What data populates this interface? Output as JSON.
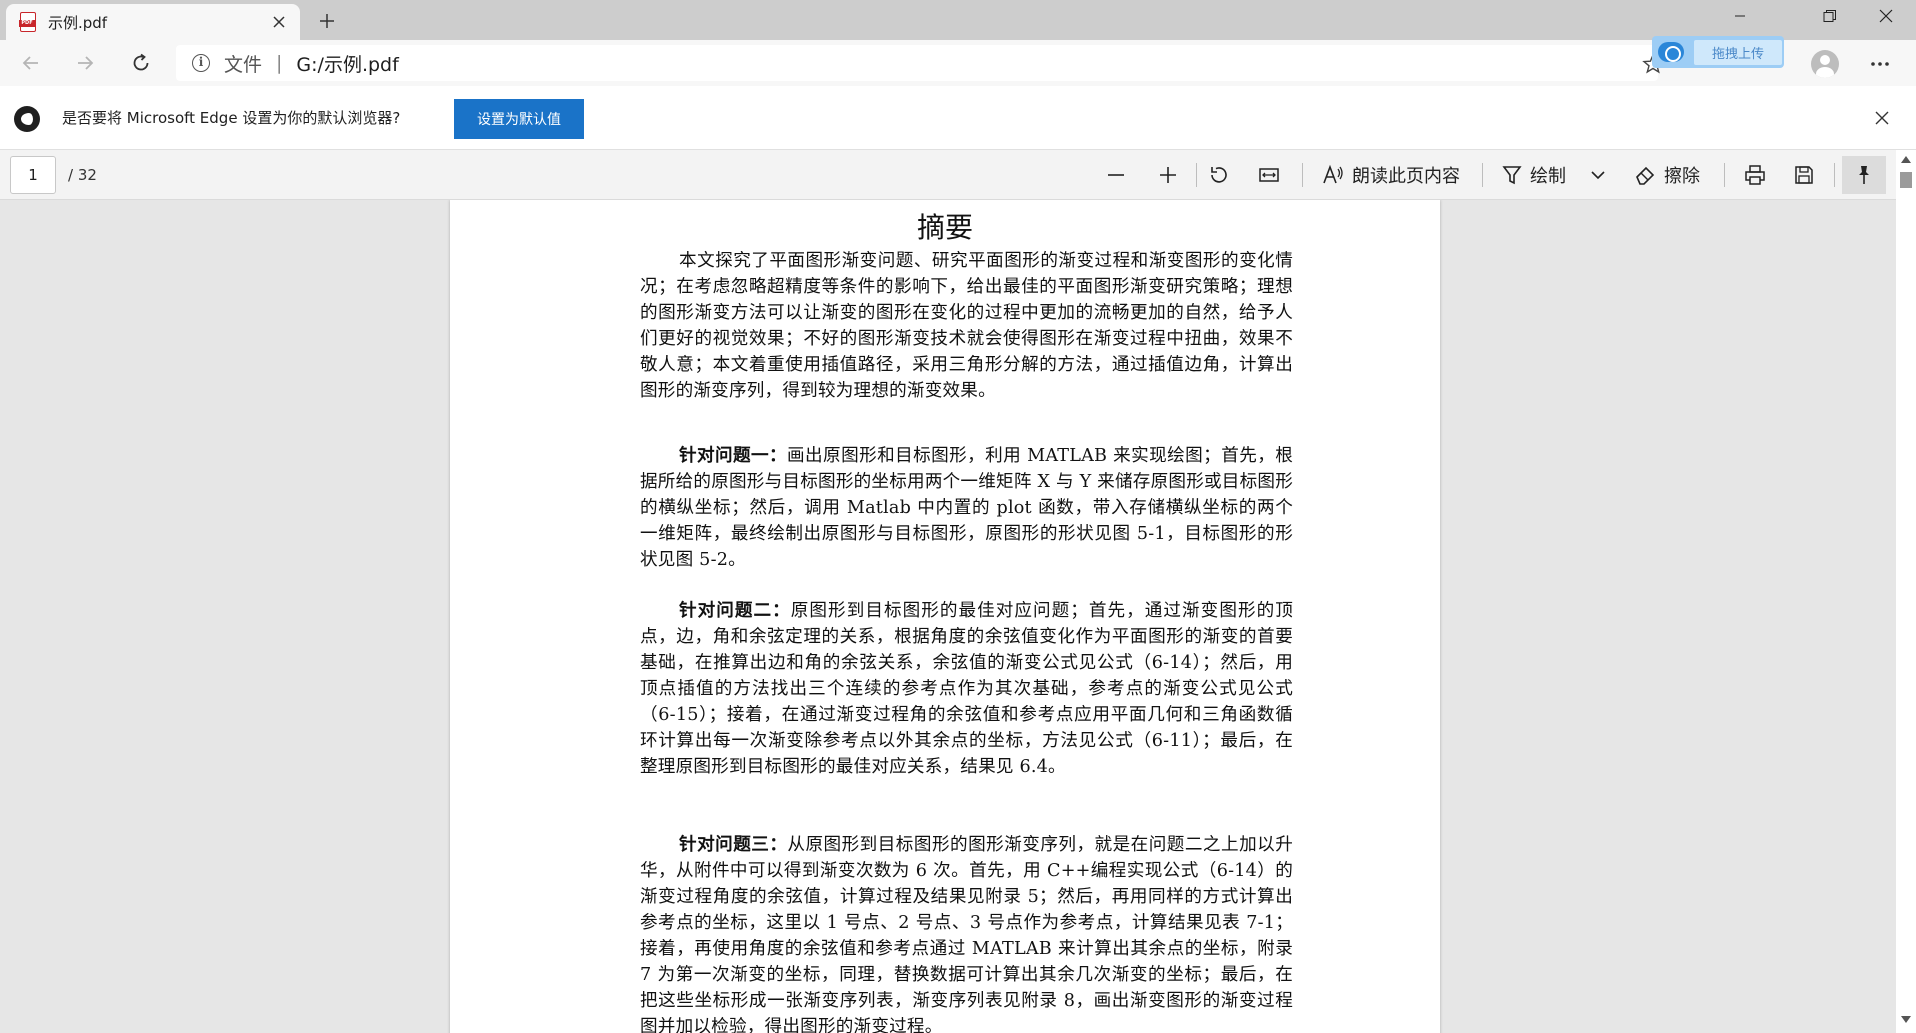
{
  "tab": {
    "title": "示例.pdf",
    "pdf_badge": "PDF"
  },
  "address": {
    "scheme": "文件",
    "separator": "|",
    "url": "G:/示例.pdf"
  },
  "upload": {
    "label": "拖拽上传"
  },
  "infobar": {
    "message": "是否要将 Microsoft Edge 设置为你的默认浏览器?",
    "button": "设置为默认值"
  },
  "pdf_toolbar": {
    "current_page": "1",
    "total_pages": "/ 32",
    "read_aloud": "朗读此页内容",
    "draw": "绘制",
    "erase": "擦除"
  },
  "document": {
    "title": "摘要",
    "paragraphs": [
      {
        "lead": "",
        "text": "本文探究了平面图形渐变问题、研究平面图形的渐变过程和渐变图形的变化情况；在考虑忽略超精度等条件的影响下，给出最佳的平面图形渐变研究策略；理想的图形渐变方法可以让渐变的图形在变化的过程中更加的流畅更加的自然，给予人们更好的视觉效果；不好的图形渐变技术就会使得图形在渐变过程中扭曲，效果不敬人意；本文着重使用插值路径，采用三角形分解的方法，通过插值边角，计算出图形的渐变序列，得到较为理想的渐变效果。"
      },
      {
        "lead": "针对问题一：",
        "text": "画出原图形和目标图形，利用 MATLAB 来实现绘图；首先，根据所给的原图形与目标图形的坐标用两个一维矩阵 X 与 Y 来储存原图形或目标图形的横纵坐标；然后，调用 Matlab 中内置的 plot 函数，带入存储横纵坐标的两个一维矩阵，最终绘制出原图形与目标图形，原图形的形状见图 5-1，目标图形的形状见图 5-2。"
      },
      {
        "lead": "针对问题二：",
        "text": "原图形到目标图形的最佳对应问题；首先，通过渐变图形的顶点，边，角和余弦定理的关系，根据角度的余弦值变化作为平面图形的渐变的首要基础，在推算出边和角的余弦关系，余弦值的渐变公式见公式（6-14）；然后，用顶点插值的方法找出三个连续的参考点作为其次基础，参考点的渐变公式见公式（6-15）；接着，在通过渐变过程角的余弦值和参考点应用平面几何和三角函数循环计算出每一次渐变除参考点以外其余点的坐标，方法见公式（6-11）；最后，在整理原图形到目标图形的最佳对应关系，结果见 6.4。"
      },
      {
        "lead": "针对问题三：",
        "text": "从原图形到目标图形的图形渐变序列，就是在问题二之上加以升华，从附件中可以得到渐变次数为 6 次。首先，用 C++编程实现公式（6-14）的渐变过程角度的余弦值，计算过程及结果见附录 5；然后，再用同样的方式计算出参考点的坐标，这里以 1 号点、2 号点、3 号点作为参考点，计算结果见表 7-1；接着，再使用角度的余弦值和参考点通过 MATLAB 来计算出其余点的坐标，附录 7 为第一次渐变的坐标，同理，替换数据可计算出其余几次渐变的坐标；最后，在把这些坐标形成一张渐变序列表，渐变序列表见附录 8，画出渐变图形的渐变过程图并加以检验，得出图形的渐变过程。"
      }
    ]
  }
}
